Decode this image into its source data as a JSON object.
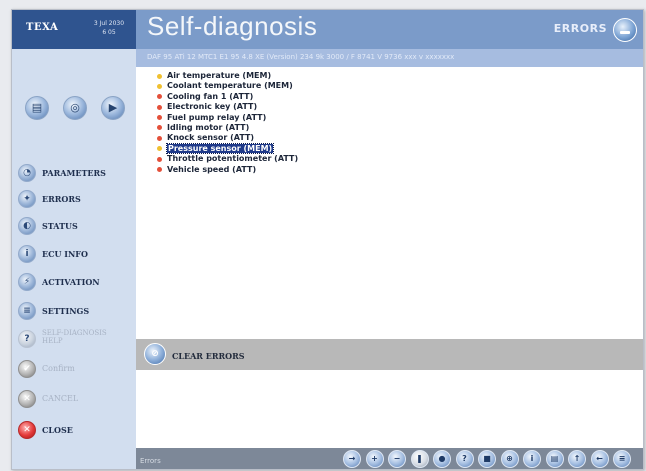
{
  "brand": {
    "logo": "TEXA",
    "date_line1": "3 Jul 2030",
    "date_line2": "6 05"
  },
  "header": {
    "title": "Self-diagnosis",
    "section": "ERRORS",
    "section_icon": "minus-circle-icon",
    "subtitle": "DAF 95 ATi 12 MTC1 E1 95 4.8 XE (Version) 234 9k 3000 / F 8741 V 9736 xxx v xxxxxxx"
  },
  "toolbar": {
    "buttons": [
      {
        "name": "print-button",
        "icon": "printer-icon",
        "glyph": "▤"
      },
      {
        "name": "refresh-button",
        "icon": "refresh-icon",
        "glyph": "◎"
      },
      {
        "name": "next-button",
        "icon": "play-icon",
        "glyph": "▶"
      }
    ]
  },
  "sidebar": {
    "items": [
      {
        "name": "sidebar-item-parameters",
        "label": "PARAMETERS",
        "icon": "gauge-icon",
        "glyph": "◔",
        "enabled": true
      },
      {
        "name": "sidebar-item-errors",
        "label": "ERRORS",
        "icon": "car-error-icon",
        "glyph": "✦",
        "enabled": true
      },
      {
        "name": "sidebar-item-status",
        "label": "STATUS",
        "icon": "status-icon",
        "glyph": "◐",
        "enabled": true
      },
      {
        "name": "sidebar-item-ecu-info",
        "label": "ECU INFO",
        "icon": "info-icon",
        "glyph": "i",
        "enabled": true
      },
      {
        "name": "sidebar-item-activation",
        "label": "ACTIVATION",
        "icon": "activation-icon",
        "glyph": "⚡",
        "enabled": true
      },
      {
        "name": "sidebar-item-settings",
        "label": "SETTINGS",
        "icon": "settings-icon",
        "glyph": "≡",
        "enabled": true
      },
      {
        "name": "sidebar-item-self-diagnosis-help",
        "label": "SELF-DIAGNOSIS",
        "label_line2": "HELP",
        "icon": "help-icon",
        "glyph": "?",
        "enabled": false
      },
      {
        "name": "sidebar-item-confirm",
        "label": "Confirm",
        "icon": "checkmark-icon",
        "glyph": "✔",
        "enabled": false
      },
      {
        "name": "sidebar-item-cancel",
        "label": "CANCEL",
        "icon": "cancel-icon",
        "glyph": "✕",
        "enabled": false
      },
      {
        "name": "sidebar-item-close",
        "label": "CLOSE",
        "icon": "close-icon",
        "glyph": "✕",
        "enabled": true
      }
    ]
  },
  "errors": {
    "items": [
      {
        "label": "Air temperature (MEM)",
        "status": "memorized",
        "color": "#f0c030",
        "selected": false
      },
      {
        "label": "Coolant temperature (MEM)",
        "status": "memorized",
        "color": "#f0c030",
        "selected": false
      },
      {
        "label": "Cooling fan 1 (ATT)",
        "status": "active",
        "color": "#e4503a",
        "selected": false
      },
      {
        "label": "Electronic key (ATT)",
        "status": "active",
        "color": "#e4503a",
        "selected": false
      },
      {
        "label": "Fuel pump relay (ATT)",
        "status": "active",
        "color": "#e4503a",
        "selected": false
      },
      {
        "label": "Idling motor (ATT)",
        "status": "active",
        "color": "#e4503a",
        "selected": false
      },
      {
        "label": "Knock sensor (ATT)",
        "status": "active",
        "color": "#e4503a",
        "selected": false
      },
      {
        "label": "Pressure sensor (MEM)",
        "status": "memorized",
        "color": "#f0c030",
        "selected": true
      },
      {
        "label": "Throttle potentiometer (ATT)",
        "status": "active",
        "color": "#e4503a",
        "selected": false
      },
      {
        "label": "Vehicle speed (ATT)",
        "status": "active",
        "color": "#e4503a",
        "selected": false
      }
    ]
  },
  "actions": {
    "clear_errors_label": "CLEAR ERRORS",
    "clear_errors_icon": "clear-errors-icon"
  },
  "statusbar": {
    "label": "Errors",
    "nav_buttons": [
      {
        "name": "nav-forward-button",
        "icon": "arrow-right-icon",
        "glyph": "→"
      },
      {
        "name": "nav-plus-button",
        "icon": "plus-icon",
        "glyph": "+"
      },
      {
        "name": "nav-minus-button",
        "icon": "minus-icon",
        "glyph": "−"
      },
      {
        "name": "nav-pause-button",
        "icon": "pause-icon",
        "glyph": "❚"
      },
      {
        "name": "nav-record-button",
        "icon": "record-icon",
        "glyph": "●"
      },
      {
        "name": "nav-help-button",
        "icon": "question-icon",
        "glyph": "?"
      },
      {
        "name": "nav-stop-button",
        "icon": "stop-icon",
        "glyph": "■"
      },
      {
        "name": "nav-zoom-button",
        "icon": "zoom-icon",
        "glyph": "⊕"
      },
      {
        "name": "nav-info-button",
        "icon": "info-icon",
        "glyph": "i"
      },
      {
        "name": "nav-print-button",
        "icon": "printer-icon",
        "glyph": "▤"
      },
      {
        "name": "nav-up-button",
        "icon": "arrow-up-icon",
        "glyph": "↑"
      },
      {
        "name": "nav-back-button",
        "icon": "arrow-left-icon",
        "glyph": "←"
      },
      {
        "name": "nav-menu-button",
        "icon": "menu-icon",
        "glyph": "≡"
      }
    ]
  }
}
